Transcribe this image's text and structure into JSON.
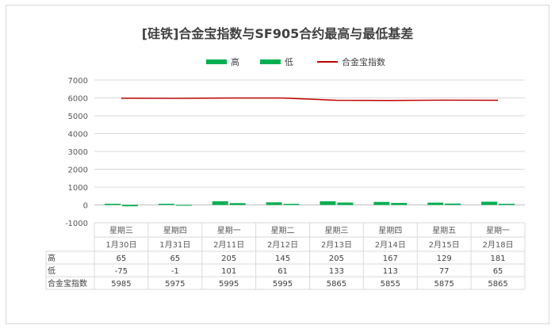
{
  "chart_data": {
    "type": "bar",
    "title": "[硅铁]合金宝指数与SF905合约最高与最低基差",
    "weekdays": [
      "星期三",
      "星期四",
      "星期一",
      "星期二",
      "星期三",
      "星期四",
      "星期五",
      "星期一"
    ],
    "dates": [
      "1月30日",
      "1月31日",
      "2月11日",
      "2月12日",
      "2月13日",
      "2月14日",
      "2月15日",
      "2月18日"
    ],
    "ylim": [
      -1000,
      7000
    ],
    "yticks": [
      -1000,
      0,
      1000,
      2000,
      3000,
      4000,
      5000,
      6000,
      7000
    ],
    "grid": true,
    "legend_position": "top",
    "series": [
      {
        "name": "高",
        "type": "bar",
        "color": "#00b050",
        "values": [
          65,
          65,
          205,
          145,
          205,
          167,
          129,
          181
        ]
      },
      {
        "name": "低",
        "type": "bar",
        "color": "#00b050",
        "values": [
          -75,
          -1,
          101,
          61,
          133,
          113,
          77,
          65
        ]
      },
      {
        "name": "合金宝指数",
        "type": "line",
        "color": "#c00000",
        "values": [
          5985,
          5975,
          5995,
          5995,
          5865,
          5855,
          5875,
          5865
        ]
      }
    ]
  }
}
